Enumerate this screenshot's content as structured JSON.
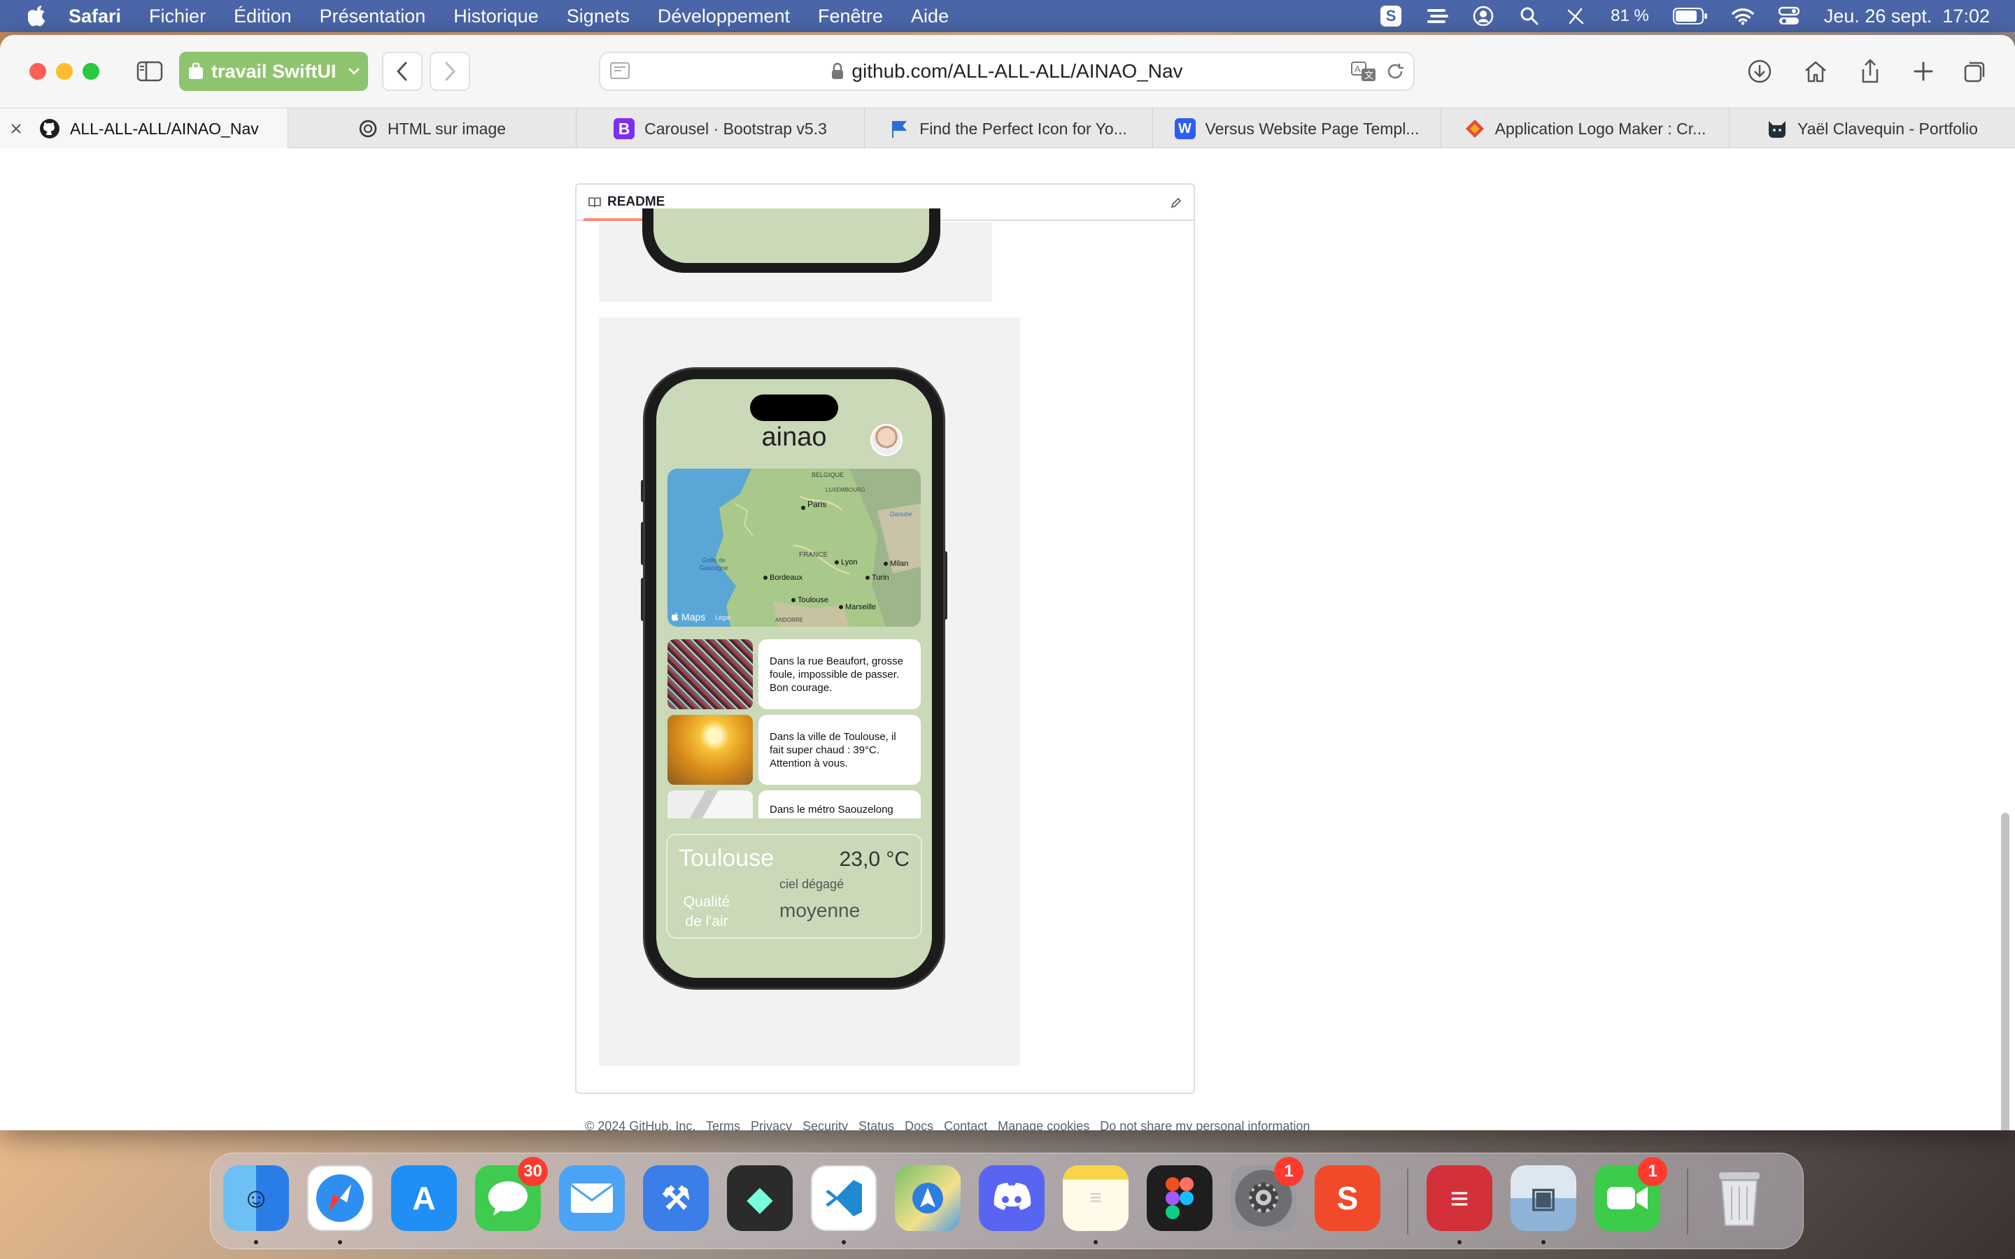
{
  "menubar": {
    "app": "Safari",
    "items": [
      "Fichier",
      "Édition",
      "Présentation",
      "Historique",
      "Signets",
      "Développement",
      "Fenêtre",
      "Aide"
    ],
    "battery": "81 %",
    "datetime": "Jeu. 26 sept.  17:02"
  },
  "toolbar": {
    "profile_label": "travail SwiftUI",
    "url": "github.com/ALL-ALL-ALL/AINAO_Nav"
  },
  "tabs": [
    {
      "label": "ALL-ALL-ALL/AINAO_Nav",
      "icon": "github-icon"
    },
    {
      "label": "HTML sur image",
      "icon": "openai-icon"
    },
    {
      "label": "Carousel · Bootstrap v5.3",
      "icon": "bootstrap-icon"
    },
    {
      "label": "Find the Perfect Icon for Yo...",
      "icon": "flag-icon"
    },
    {
      "label": "Versus Website Page Templ...",
      "icon": "webflow-icon"
    },
    {
      "label": "Application Logo Maker : Cr...",
      "icon": "diamond-logo-icon"
    },
    {
      "label": "Yaël Clavequin - Portfolio",
      "icon": "cat-icon"
    }
  ],
  "readme": {
    "title": "README"
  },
  "phone": {
    "app_title": "ainao",
    "map": {
      "brand": "Maps",
      "legal": "Légal",
      "labels": [
        "BELGIQUE",
        "LUXEMBOURG",
        "Paris",
        "FRANCE",
        "Golfe de Gascogne",
        "Bordeaux",
        "Lyon",
        "Milan",
        "Turin",
        "Toulouse",
        "Marseille",
        "ANDORRE",
        "Danube"
      ]
    },
    "news": [
      {
        "text": "Dans la rue Beaufort, grosse foule, impossible de passer. Bon courage."
      },
      {
        "text": "Dans la ville de Toulouse, il fait super chaud : 39°C. Attention à vous."
      },
      {
        "text": "Dans le métro Saouzelong"
      }
    ],
    "weather": {
      "city": "Toulouse",
      "temperature": "23,0 °C",
      "condition": "ciel dégagé",
      "air_label_1": "Qualité",
      "air_label_2": "de l'air",
      "air_value": "moyenne"
    }
  },
  "footer": {
    "text": "© 2024 GitHub, Inc.   Terms   Privacy   Security   Status   Docs   Contact   Manage cookies   Do not share my personal information"
  },
  "dock": {
    "apps": [
      {
        "name": "Finder",
        "color": "#3b8ef0"
      },
      {
        "name": "Safari",
        "color": "#2f8ff0"
      },
      {
        "name": "App Store",
        "color": "#1f8ff5"
      },
      {
        "name": "Messages",
        "color": "#3fcb4f",
        "badge": "30"
      },
      {
        "name": "Mail",
        "color": "#4aa3f5"
      },
      {
        "name": "Xcode",
        "color": "#3b7ee8"
      },
      {
        "name": "Simulator",
        "color": "#2b2b2b"
      },
      {
        "name": "Visual Studio Code",
        "color": "#ffffff"
      },
      {
        "name": "Plans",
        "color": "#78c26a"
      },
      {
        "name": "Discord",
        "color": "#5865f2"
      },
      {
        "name": "Notes",
        "color": "#fff6c8"
      },
      {
        "name": "Figma",
        "color": "#1e1e1e"
      },
      {
        "name": "Réglages Système",
        "color": "#8a8a8e",
        "badge": "1"
      },
      {
        "name": "Scribens",
        "color": "#f04a2a",
        "letter": "S"
      },
      {
        "name": "ExpressVPN",
        "color": "#d3303a"
      },
      {
        "name": "Aperçu",
        "color": "#8fb3d8"
      },
      {
        "name": "FaceTime",
        "color": "#3ccb4a",
        "badge": "1"
      },
      {
        "name": "Corbeille",
        "color": "#d8dbe0"
      }
    ]
  }
}
